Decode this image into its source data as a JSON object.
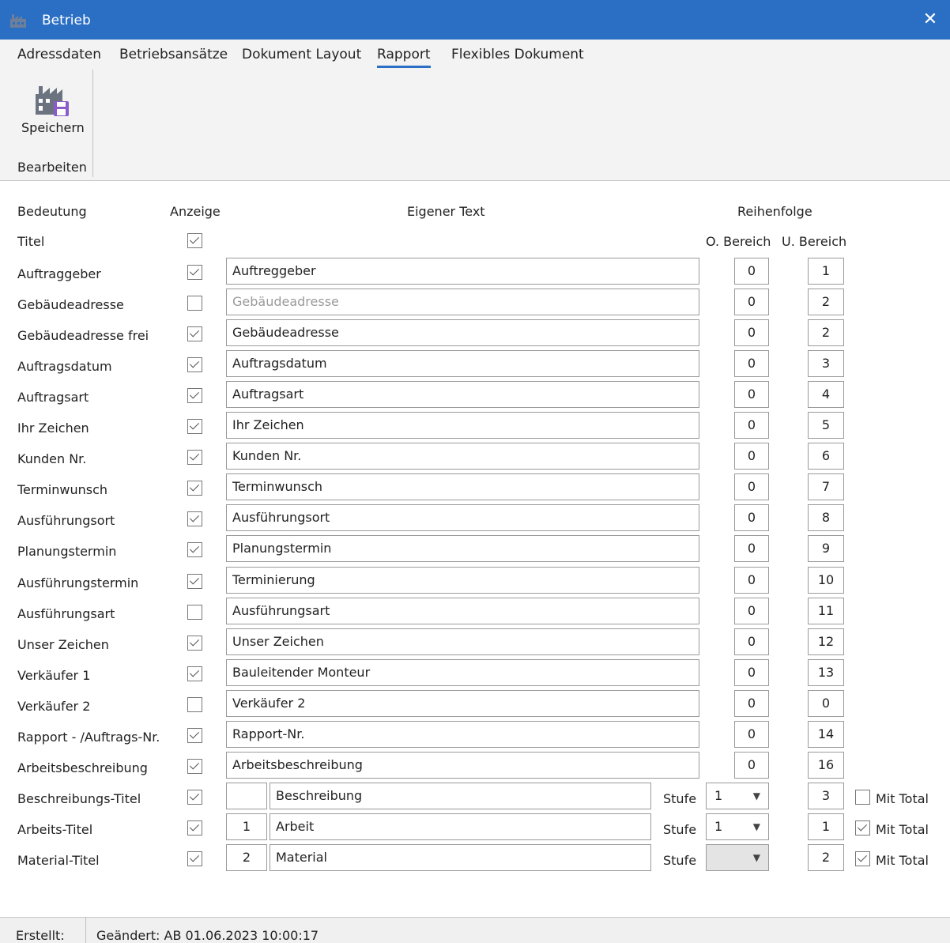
{
  "window": {
    "title": "Betrieb",
    "close_label": "✕"
  },
  "tabs": [
    {
      "label": "Adressdaten",
      "active": false
    },
    {
      "label": "Betriebsansätze",
      "active": false
    },
    {
      "label": "Dokument Layout",
      "active": false
    },
    {
      "label": "Rapport",
      "active": true
    },
    {
      "label": "Flexibles Dokument",
      "active": false
    }
  ],
  "ribbon": {
    "save_label": "Speichern",
    "group_label": "Bearbeiten",
    "accent_color": "#2b6fc4",
    "save_icon": "factory-save-icon"
  },
  "headers": {
    "bedeutung": "Bedeutung",
    "anzeige": "Anzeige",
    "eigener_text": "Eigener Text",
    "reihenfolge": "Reihenfolge",
    "o_bereich": "O. Bereich",
    "u_bereich": "U. Bereich"
  },
  "title_row": {
    "label": "Titel",
    "checked": true
  },
  "rows": [
    {
      "label": "Auftraggeber",
      "checked": true,
      "text": "Auftreggeber",
      "o": "0",
      "u": "1"
    },
    {
      "label": "Gebäudeadresse",
      "checked": false,
      "text": "Gebäudeadresse",
      "placeholder": true,
      "o": "0",
      "u": "2"
    },
    {
      "label": "Gebäudeadresse frei",
      "checked": true,
      "text": "Gebäudeadresse",
      "o": "0",
      "u": "2"
    },
    {
      "label": "Auftragsdatum",
      "checked": true,
      "text": "Auftragsdatum",
      "o": "0",
      "u": "3"
    },
    {
      "label": "Auftragsart",
      "checked": true,
      "text": "Auftragsart",
      "o": "0",
      "u": "4"
    },
    {
      "label": "Ihr Zeichen",
      "checked": true,
      "text": "Ihr Zeichen",
      "o": "0",
      "u": "5"
    },
    {
      "label": "Kunden Nr.",
      "checked": true,
      "text": "Kunden Nr.",
      "o": "0",
      "u": "6"
    },
    {
      "label": "Terminwunsch",
      "checked": true,
      "text": "Terminwunsch",
      "o": "0",
      "u": "7"
    },
    {
      "label": "Ausführungsort",
      "checked": true,
      "text": "Ausführungsort",
      "o": "0",
      "u": "8"
    },
    {
      "label": "Planungstermin",
      "checked": true,
      "text": "Planungstermin",
      "o": "0",
      "u": "9"
    },
    {
      "label": "Ausführungstermin",
      "checked": true,
      "text": "Terminierung",
      "o": "0",
      "u": "10"
    },
    {
      "label": "Ausführungsart",
      "checked": false,
      "text": "Ausführungsart",
      "o": "0",
      "u": "11"
    },
    {
      "label": "Unser Zeichen",
      "checked": true,
      "text": "Unser Zeichen",
      "o": "0",
      "u": "12"
    },
    {
      "label": "Verkäufer 1",
      "checked": true,
      "text": "Bauleitender Monteur",
      "o": "0",
      "u": "13"
    },
    {
      "label": "Verkäufer 2",
      "checked": false,
      "text": "Verkäufer 2",
      "o": "0",
      "u": "0"
    },
    {
      "label": "Rapport - /Auftrags-Nr.",
      "checked": true,
      "text": "Rapport-Nr.",
      "o": "0",
      "u": "14"
    },
    {
      "label": "Arbeitsbeschreibung",
      "checked": true,
      "text": "Arbeitsbeschreibung",
      "o": "0",
      "u": "16"
    }
  ],
  "level_rows": [
    {
      "label": "Beschreibungs-Titel",
      "checked": true,
      "prefix": "",
      "text": "Beschreibung",
      "stufe_label": "Stufe",
      "stufe": "1",
      "stufe_disabled": false,
      "u": "3",
      "mit_total": false,
      "mit_total_label": "Mit Total"
    },
    {
      "label": "Arbeits-Titel",
      "checked": true,
      "prefix": "1",
      "text": "Arbeit",
      "stufe_label": "Stufe",
      "stufe": "1",
      "stufe_disabled": false,
      "u": "1",
      "mit_total": true,
      "mit_total_label": "Mit Total"
    },
    {
      "label": "Material-Titel",
      "checked": true,
      "prefix": "2",
      "text": "Material",
      "stufe_label": "Stufe",
      "stufe": "",
      "stufe_disabled": true,
      "u": "2",
      "mit_total": true,
      "mit_total_label": "Mit Total"
    }
  ],
  "status": {
    "created": "Erstellt:",
    "changed": "Geändert:   AB 01.06.2023 10:00:17"
  }
}
